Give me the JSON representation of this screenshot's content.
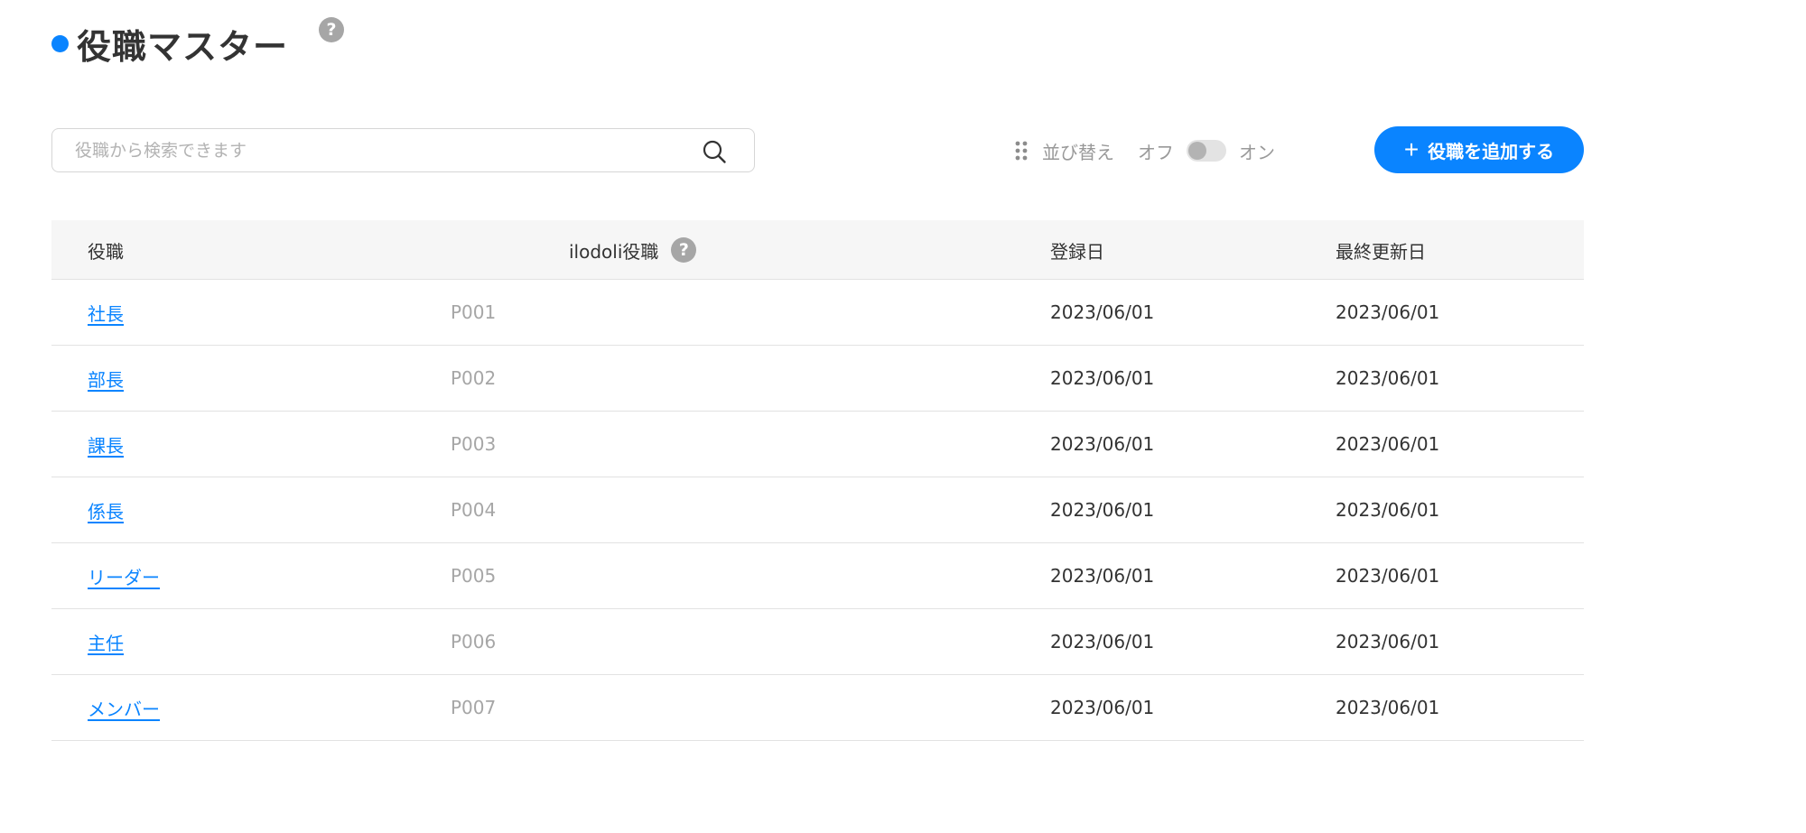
{
  "header": {
    "title": "役職マスター",
    "help_glyph": "?"
  },
  "search": {
    "placeholder": "役職から検索できます",
    "value": ""
  },
  "sort": {
    "label": "並び替え",
    "off_label": "オフ",
    "on_label": "オン",
    "enabled": false
  },
  "add_button": {
    "plus": "+",
    "label": "役職を追加する"
  },
  "table": {
    "columns": [
      "役職",
      "ilodoli役職",
      "登録日",
      "最終更新日"
    ],
    "rows": [
      {
        "name": "社長",
        "code": "P001",
        "created": "2023/06/01",
        "updated": "2023/06/01"
      },
      {
        "name": "部長",
        "code": "P002",
        "created": "2023/06/01",
        "updated": "2023/06/01"
      },
      {
        "name": "課長",
        "code": "P003",
        "created": "2023/06/01",
        "updated": "2023/06/01"
      },
      {
        "name": "係長",
        "code": "P004",
        "created": "2023/06/01",
        "updated": "2023/06/01"
      },
      {
        "name": "リーダー",
        "code": "P005",
        "created": "2023/06/01",
        "updated": "2023/06/01"
      },
      {
        "name": "主任",
        "code": "P006",
        "created": "2023/06/01",
        "updated": "2023/06/01"
      },
      {
        "name": "メンバー",
        "code": "P007",
        "created": "2023/06/01",
        "updated": "2023/06/01"
      }
    ]
  },
  "colors": {
    "accent": "#0a84ff",
    "header_bg": "#f6f6f6",
    "muted_text": "#a6a6a6"
  },
  "icons": [
    "help-icon",
    "search-icon",
    "drag-handle-icon",
    "plus-icon"
  ]
}
